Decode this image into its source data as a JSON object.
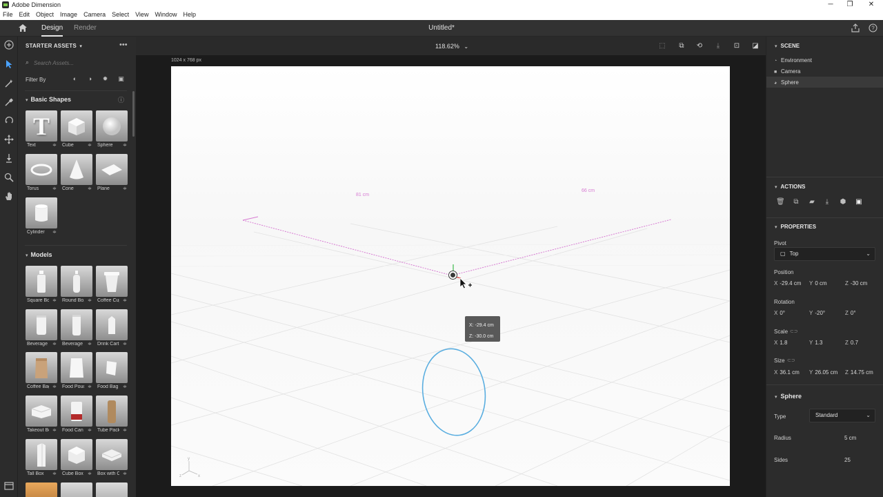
{
  "window": {
    "app_title": "Adobe Dimension",
    "minimize": "─",
    "maximize": "❐",
    "close": "✕"
  },
  "menu": [
    "File",
    "Edit",
    "Object",
    "Image",
    "Camera",
    "Select",
    "View",
    "Window",
    "Help"
  ],
  "topbar": {
    "tab_design": "Design",
    "tab_render": "Render",
    "document_title": "Untitled*"
  },
  "tools": [
    "add-icon",
    "select-icon",
    "magic-wand-icon",
    "eyedropper-icon",
    "orbit-icon",
    "pan-icon",
    "dolly-icon",
    "zoom-icon",
    "hand-icon"
  ],
  "assets": {
    "header": "STARTER ASSETS",
    "search_placeholder": "Search Assets...",
    "filter_by": "Filter By",
    "basic_shapes_title": "Basic Shapes",
    "models_title": "Models",
    "basic_shapes": [
      {
        "label": "Text"
      },
      {
        "label": "Cube"
      },
      {
        "label": "Sphere"
      },
      {
        "label": "Torus"
      },
      {
        "label": "Cone"
      },
      {
        "label": "Plane"
      },
      {
        "label": "Cylinder"
      }
    ],
    "models": [
      {
        "label": "Square Bo..."
      },
      {
        "label": "Round Bo..."
      },
      {
        "label": "Coffee Cup"
      },
      {
        "label": "Beverage ..."
      },
      {
        "label": "Beverage ..."
      },
      {
        "label": "Drink Cart..."
      },
      {
        "label": "Coffee Bag"
      },
      {
        "label": "Food Pouch"
      },
      {
        "label": "Food Bag"
      },
      {
        "label": "Takeout Box"
      },
      {
        "label": "Food Can"
      },
      {
        "label": "Tube Pack..."
      },
      {
        "label": "Tall Box"
      },
      {
        "label": "Cube Box"
      },
      {
        "label": "Box with O..."
      }
    ]
  },
  "viewport": {
    "zoom": "118.62%",
    "canvas_size": "1024 x 768 px",
    "measure_left": "81 cm",
    "measure_right": "66 cm",
    "tooltip_x": "X:  -29.4 cm",
    "tooltip_z": "Z:  -30.0 cm",
    "axis_y": "y",
    "axis_z": "z",
    "axis_x": "x"
  },
  "scene": {
    "title": "SCENE",
    "items": [
      "Environment",
      "Camera",
      "Sphere"
    ]
  },
  "actions": {
    "title": "ACTIONS"
  },
  "properties": {
    "title": "PROPERTIES",
    "pivot_label": "Pivot",
    "pivot_value": "Top",
    "position_label": "Position",
    "position": {
      "x": "-29.4 cm",
      "y": "0 cm",
      "z": "-30 cm"
    },
    "rotation_label": "Rotation",
    "rotation": {
      "x": "0°",
      "y": "-20°",
      "z": "0°"
    },
    "scale_label": "Scale",
    "scale": {
      "x": "1.8",
      "y": "1.3",
      "z": "0.7"
    },
    "size_label": "Size",
    "size": {
      "x": "36.1 cm",
      "y": "26.05 cm",
      "z": "14.75 cm"
    }
  },
  "sphere": {
    "title": "Sphere",
    "type_label": "Type",
    "type_value": "Standard",
    "radius_label": "Radius",
    "radius_value": "5 cm",
    "sides_label": "Sides",
    "sides_value": "25"
  },
  "colors": {
    "accent_pink": "#e07ad8",
    "select_blue": "#4aa3ff",
    "circle_blue": "#5aaee0"
  }
}
